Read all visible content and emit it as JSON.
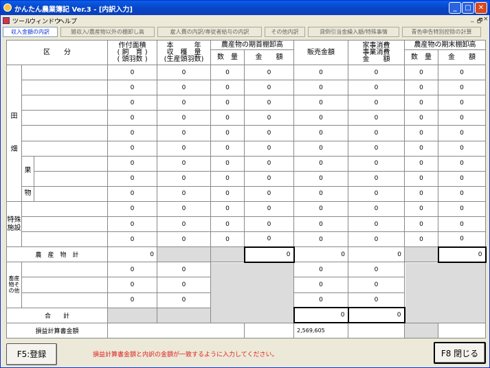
{
  "window": {
    "title": "かんたん農業簿記 Ver.3 - [内訳入力]"
  },
  "menu": [
    "ツール",
    "ウィンドウ",
    "ヘルプ"
  ],
  "mdi_controls": [
    "_",
    "🗗",
    "×"
  ],
  "tabs": [
    "収入金額の内訳",
    "雑収入/農産物以外の棚卸し高",
    "雇人費の内訳/専従者給与の内訳",
    "その他内訳",
    "貸倒引当金繰入額/特殊事情",
    "青色申告特別控除の計算"
  ],
  "headers": {
    "kubun": "区　　分",
    "sakutsuke": [
      "作付面積",
      "( 飼　育 )",
      "( 頭羽数 )"
    ],
    "shukaku": [
      "本　　　年",
      "収　穫　量",
      "(生産頭羽数)"
    ],
    "kishu": "農産物の期首棚卸高",
    "suryo": "数　量",
    "kingaku": "金　　額",
    "hanbai": "販売金額",
    "kaji": [
      "家事消費",
      "事業消費",
      "金　　額"
    ],
    "kimatsu": "農産物の期末棚卸高"
  },
  "labels": {
    "ta": "田",
    "hata": "畑",
    "ka": "果",
    "butsu": "物",
    "tokushu": "特殊施設",
    "nousanbutsu_kei": "農　産　物　計",
    "chikusan": "畜産物その他",
    "goukei": "合　　計",
    "sonneki": "損益計算書金額"
  },
  "zero": "0",
  "totals": {
    "nousanbutsu_sakutsuke": "0",
    "kishu_kingaku": "0",
    "hanbai": "0",
    "kaji": "0",
    "kimatsu_kingaku": "0",
    "goukei_hanbai": "0",
    "goukei_kaji": "0",
    "sonneki_hanbai": "2,569,605"
  },
  "footer": {
    "register": "F5:登録",
    "message": "損益計算書金額と内訳の金額が一致するように入力してください。",
    "close": "F8 閉じる"
  }
}
